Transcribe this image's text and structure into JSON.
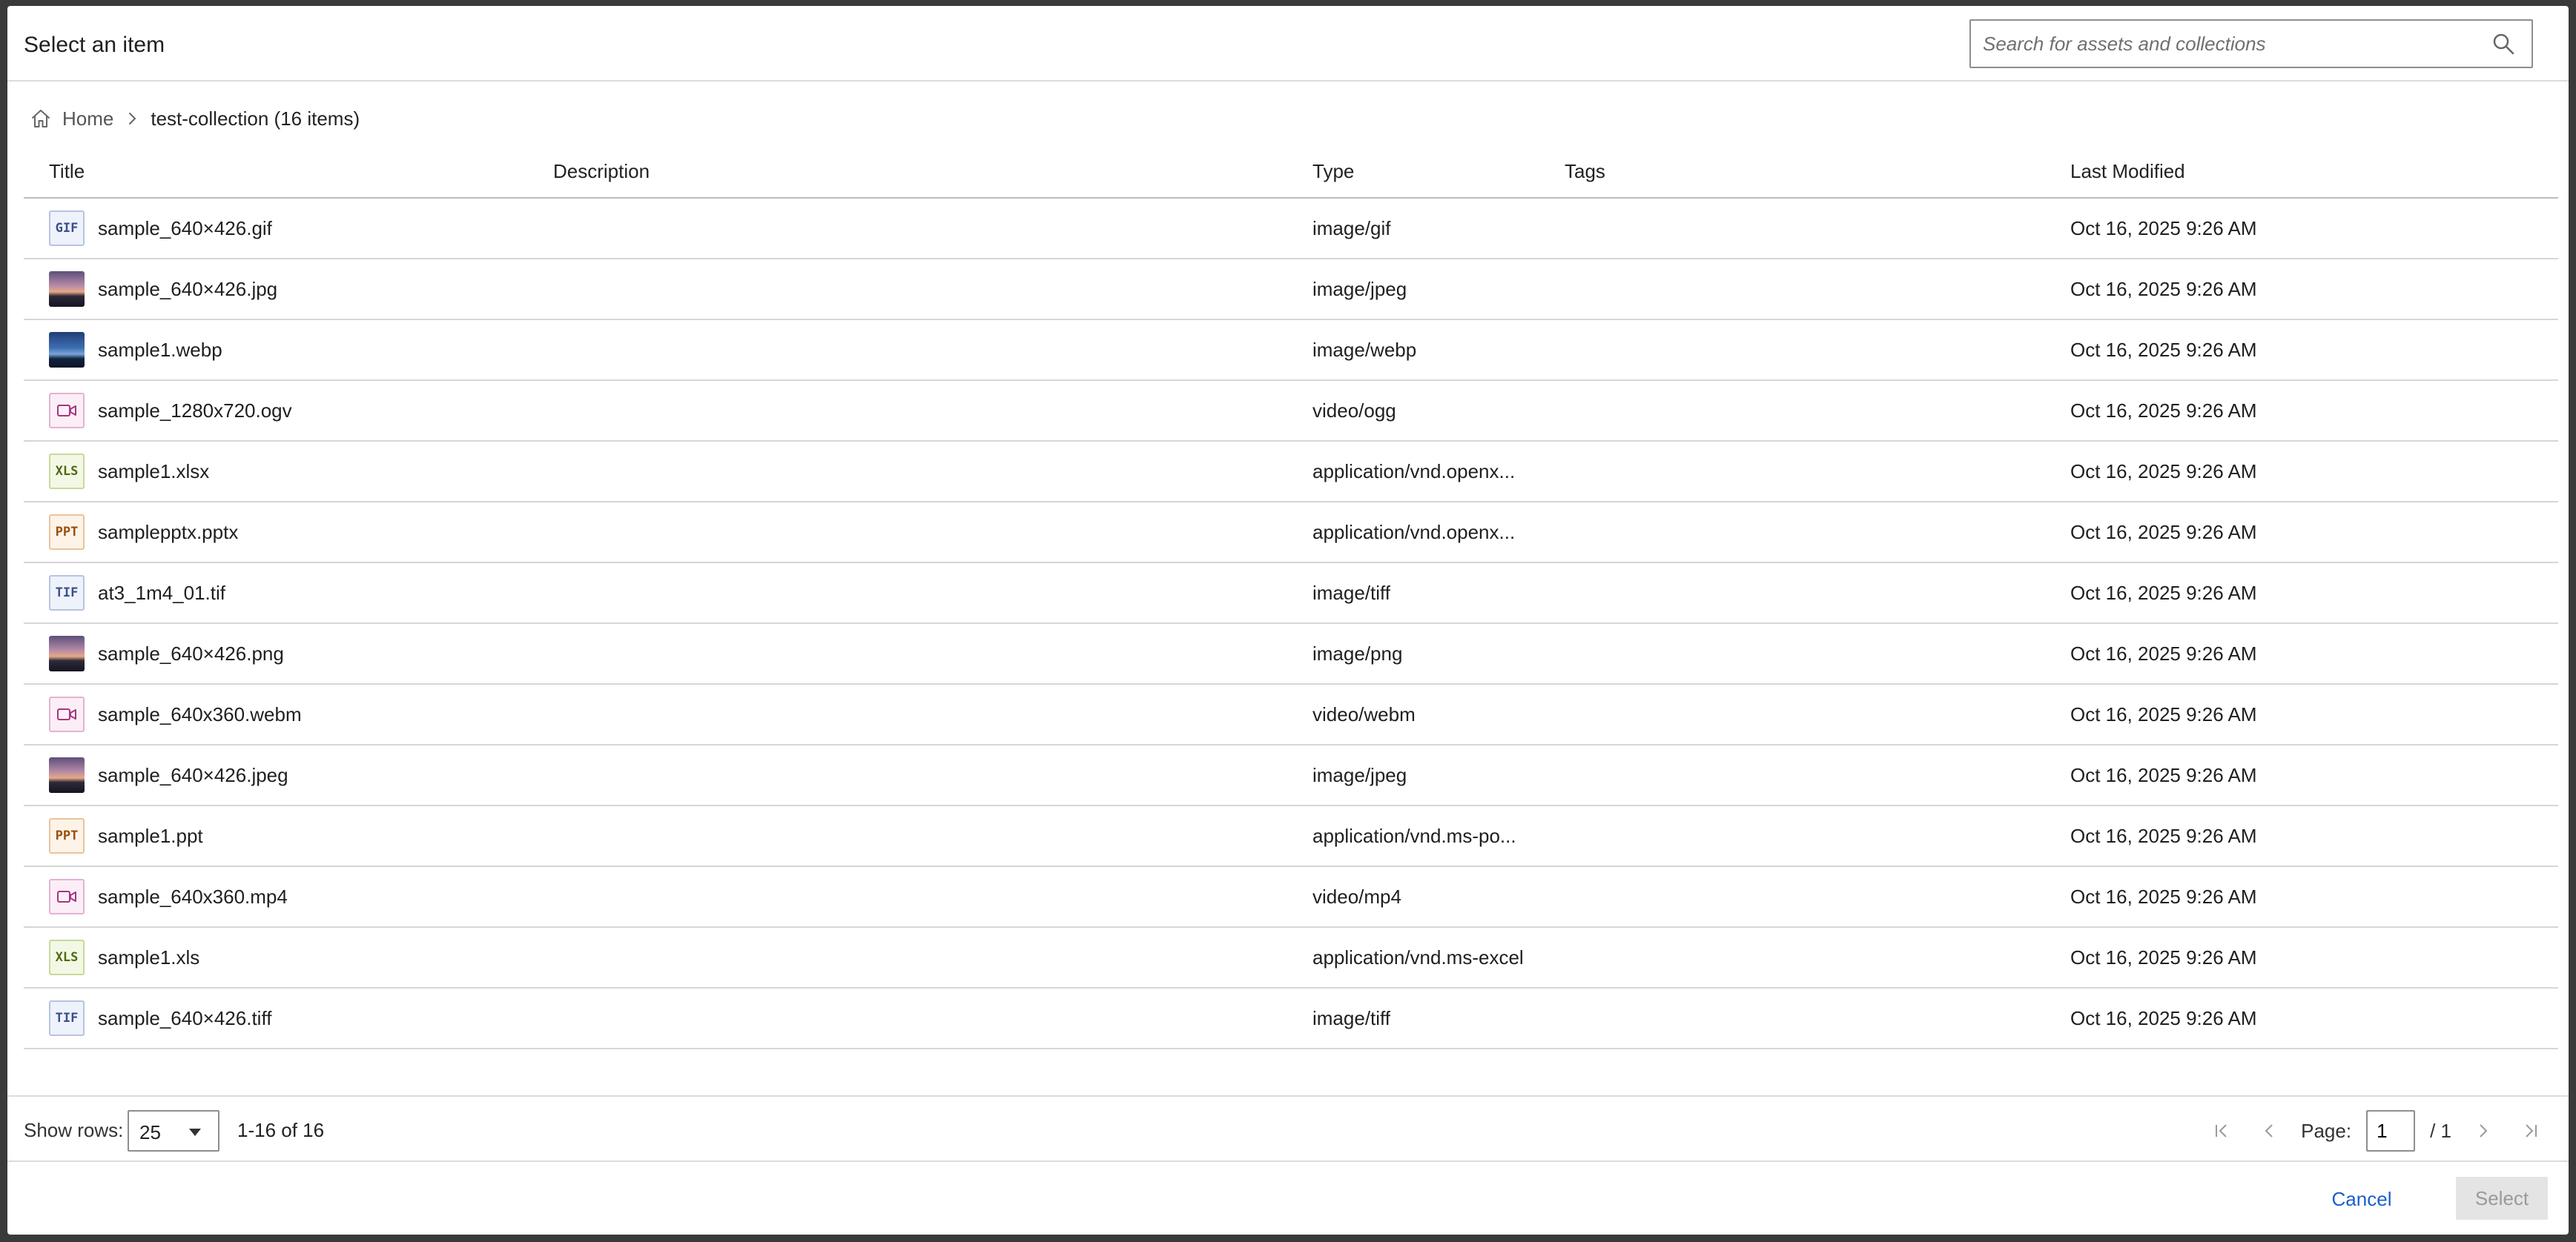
{
  "dialog": {
    "title": "Select an item"
  },
  "search": {
    "placeholder": "Search for assets and collections",
    "value": ""
  },
  "breadcrumb": {
    "home_label": "Home",
    "current": "test-collection (16 items)"
  },
  "table": {
    "columns": [
      "Title",
      "Description",
      "Type",
      "Tags",
      "Last Modified"
    ],
    "rows": [
      {
        "title": "sample_640×426.gif",
        "type": "image/gif",
        "modified": "Oct 16, 2025 9:26 AM",
        "icon": "gif-file-icon",
        "badge": "GIF"
      },
      {
        "title": "sample_640×426.jpg",
        "type": "image/jpeg",
        "modified": "Oct 16, 2025 9:26 AM",
        "icon": "image-thumbnail",
        "badge": ""
      },
      {
        "title": "sample1.webp",
        "type": "image/webp",
        "modified": "Oct 16, 2025 9:26 AM",
        "icon": "image-thumbnail",
        "badge": ""
      },
      {
        "title": "sample_1280x720.ogv",
        "type": "video/ogg",
        "modified": "Oct 16, 2025 9:26 AM",
        "icon": "video-icon",
        "badge": ""
      },
      {
        "title": "sample1.xlsx",
        "type": "application/vnd.openx...",
        "modified": "Oct 16, 2025 9:26 AM",
        "icon": "xls-file-icon",
        "badge": "XLS"
      },
      {
        "title": "samplepptx.pptx",
        "type": "application/vnd.openx...",
        "modified": "Oct 16, 2025 9:26 AM",
        "icon": "ppt-file-icon",
        "badge": "PPT"
      },
      {
        "title": "at3_1m4_01.tif",
        "type": "image/tiff",
        "modified": "Oct 16, 2025 9:26 AM",
        "icon": "tif-file-icon",
        "badge": "TIF"
      },
      {
        "title": "sample_640×426.png",
        "type": "image/png",
        "modified": "Oct 16, 2025 9:26 AM",
        "icon": "image-thumbnail",
        "badge": ""
      },
      {
        "title": "sample_640x360.webm",
        "type": "video/webm",
        "modified": "Oct 16, 2025 9:26 AM",
        "icon": "video-icon",
        "badge": ""
      },
      {
        "title": "sample_640×426.jpeg",
        "type": "image/jpeg",
        "modified": "Oct 16, 2025 9:26 AM",
        "icon": "image-thumbnail",
        "badge": ""
      },
      {
        "title": "sample1.ppt",
        "type": "application/vnd.ms-po...",
        "modified": "Oct 16, 2025 9:26 AM",
        "icon": "ppt-file-icon",
        "badge": "PPT"
      },
      {
        "title": "sample_640x360.mp4",
        "type": "video/mp4",
        "modified": "Oct 16, 2025 9:26 AM",
        "icon": "video-icon",
        "badge": ""
      },
      {
        "title": "sample1.xls",
        "type": "application/vnd.ms-excel",
        "modified": "Oct 16, 2025 9:26 AM",
        "icon": "xls-file-icon",
        "badge": "XLS"
      },
      {
        "title": "sample_640×426.tiff",
        "type": "image/tiff",
        "modified": "Oct 16, 2025 9:26 AM",
        "icon": "tif-file-icon",
        "badge": "TIF"
      }
    ]
  },
  "footer": {
    "show_rows_label": "Show rows:",
    "rows_per_page": "25",
    "range_text": "1-16 of 16",
    "page_label": "Page:",
    "page_value": "1",
    "page_total": "/ 1"
  },
  "actions": {
    "cancel_label": "Cancel",
    "select_label": "Select"
  },
  "colors": {
    "link": "#1a5fc9",
    "disabled_bg": "#e4e4e4",
    "border": "#d6d6d6"
  }
}
